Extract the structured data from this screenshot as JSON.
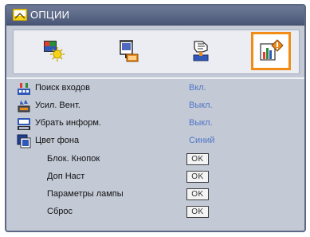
{
  "window": {
    "title": "ОПЦИИ"
  },
  "tabs": [
    {
      "name": "image-settings-tab",
      "icon": "image-brightness-icon",
      "active": false
    },
    {
      "name": "display-settings-tab",
      "icon": "screen-display-icon",
      "active": false
    },
    {
      "name": "setup-tab",
      "icon": "setup-hand-icon",
      "active": false
    },
    {
      "name": "options-tab",
      "icon": "options-bar-chart-icon",
      "active": true
    }
  ],
  "options": {
    "source_lock": {
      "label": "Поиск входов",
      "value": "Вкл.",
      "icon": "source-search-icon"
    },
    "high_altitude": {
      "label": "Усил. Вент.",
      "value": "Выкл.",
      "icon": "fan-boost-icon"
    },
    "info_hide": {
      "label": "Убрать информ.",
      "value": "Выкл.",
      "icon": "info-hide-icon"
    },
    "background_color": {
      "label": "Цвет фона",
      "value": "Синий",
      "icon": "background-color-icon"
    },
    "keypad_lock": {
      "label": "Блок. Кнопок",
      "button": "OK"
    },
    "advanced": {
      "label": "Доп Наст",
      "button": "OK"
    },
    "lamp_settings": {
      "label": "Параметры лампы",
      "button": "OK"
    },
    "reset": {
      "label": "Сброс",
      "button": "OK"
    }
  },
  "colors": {
    "frame": "#5b6784",
    "panel": "#c3c9d5",
    "accent_orange": "#f28c16",
    "value_blue": "#4f75c8"
  }
}
